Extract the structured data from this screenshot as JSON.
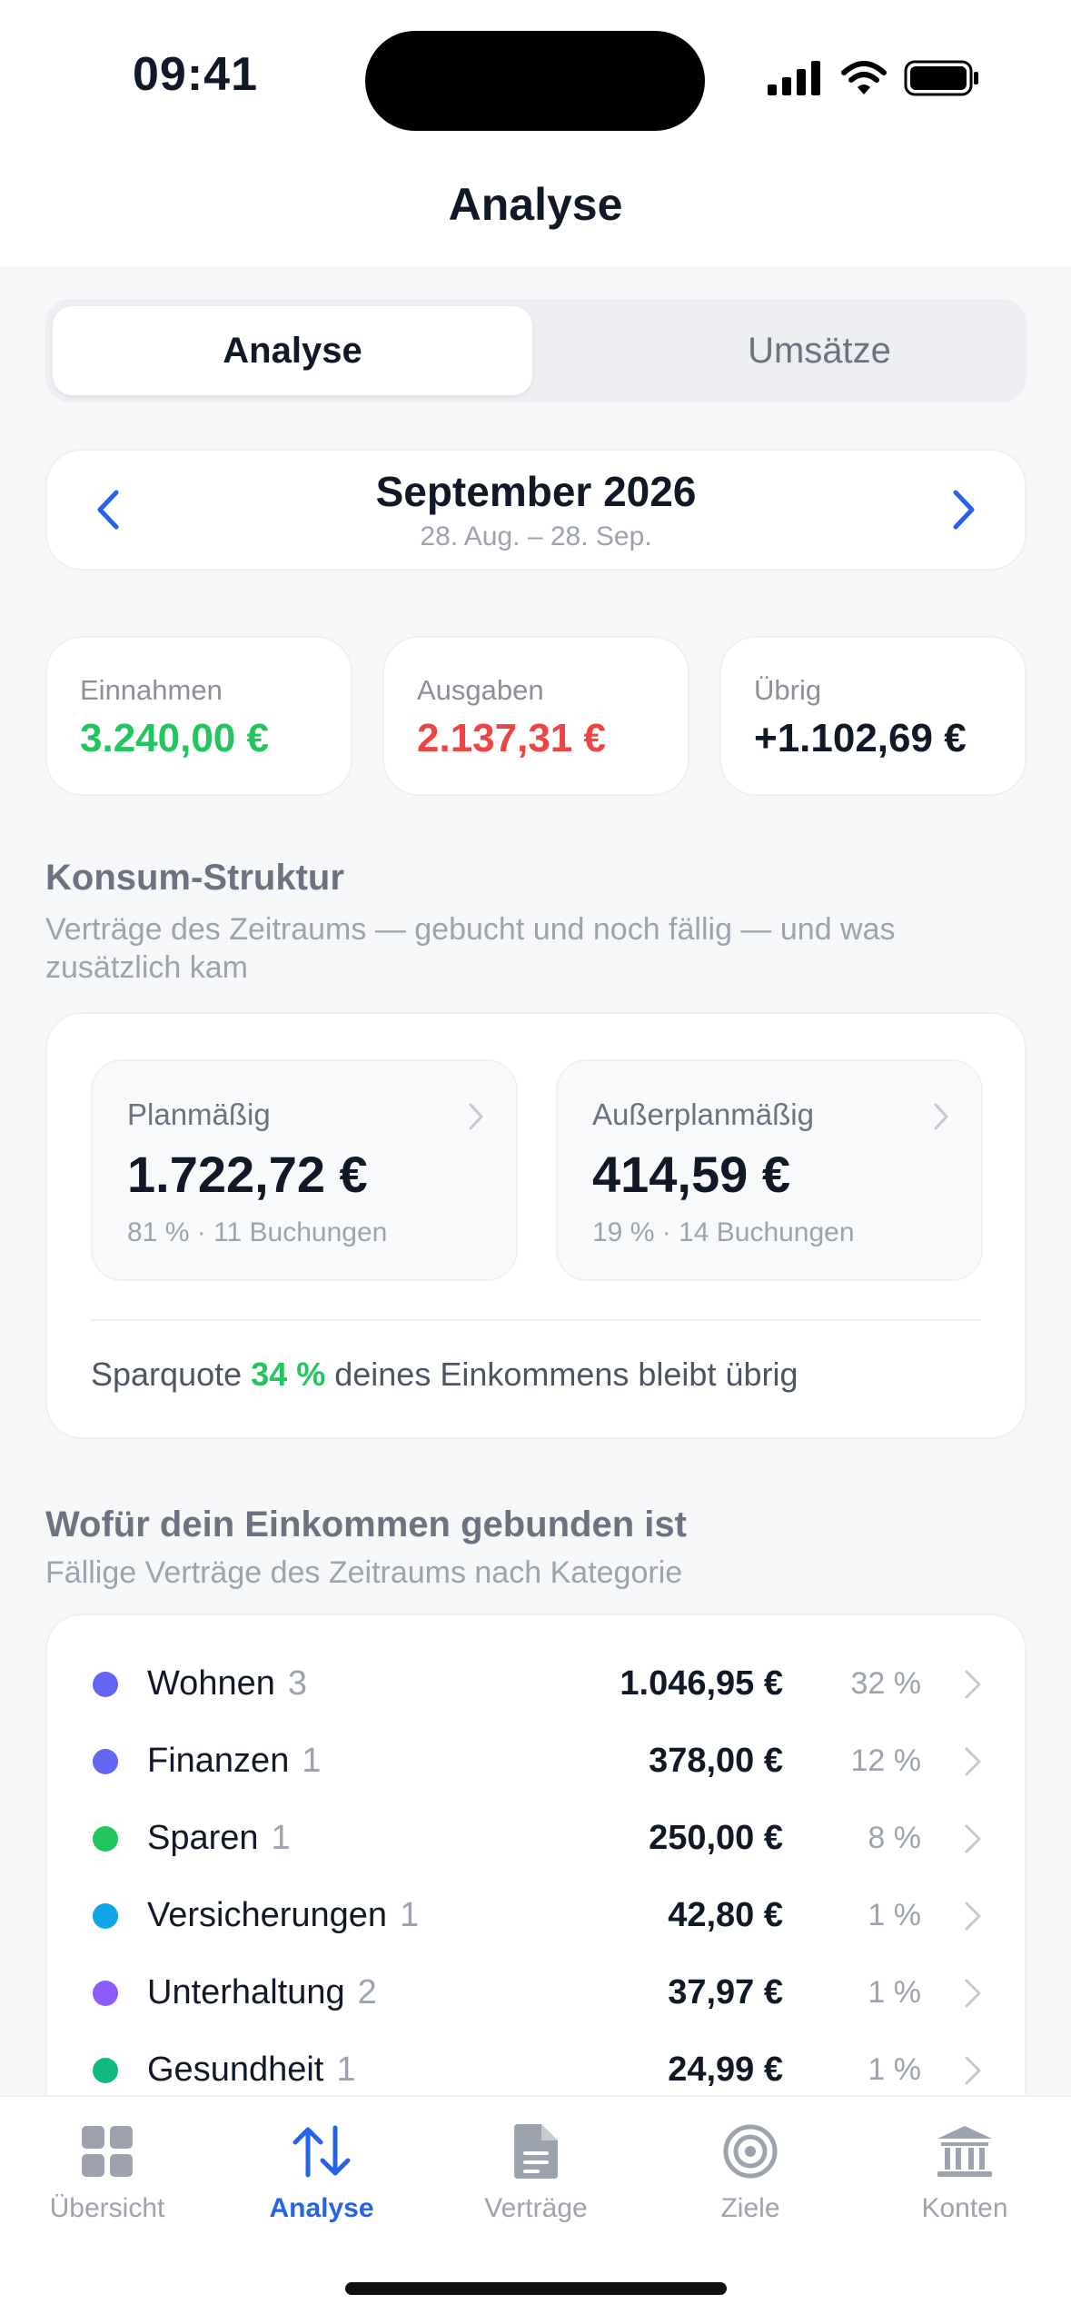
{
  "status": {
    "time": "09:41"
  },
  "nav": {
    "title": "Analyse"
  },
  "segment": {
    "active": "Analyse",
    "inactive": "Umsätze"
  },
  "period": {
    "title": "September 2026",
    "range": "28. Aug. – 28. Sep."
  },
  "stats": [
    {
      "label": "Einnahmen",
      "value": "3.240,00 €",
      "color": "#22c55e"
    },
    {
      "label": "Ausgaben",
      "value": "2.137,31 €",
      "color": "#ef4444"
    },
    {
      "label": "Übrig",
      "value": "+1.102,69 €",
      "color": "#111827"
    }
  ],
  "konsum": {
    "title": "Konsum-Struktur",
    "subtitle": "Verträge des Zeitraums — gebucht und noch fällig — und was zusätzlich kam",
    "planned": {
      "label": "Planmäßig",
      "value": "1.722,72 €",
      "meta": "81 % · 11 Buchungen"
    },
    "unplanned": {
      "label": "Außerplanmäßig",
      "value": "414,59 €",
      "meta": "19 % · 14 Buchungen"
    },
    "savings": {
      "prefix": "Sparquote",
      "pct": "34 %",
      "suffix": "deines Einkommens bleibt übrig"
    }
  },
  "categories": {
    "title": "Wofür dein Einkommen gebunden ist",
    "subtitle": "Fällige Verträge des Zeitraums nach Kategorie",
    "items": [
      {
        "name": "Wohnen",
        "count": "3",
        "amount": "1.046,95 €",
        "pct": "32 %",
        "color": "#6366f1"
      },
      {
        "name": "Finanzen",
        "count": "1",
        "amount": "378,00 €",
        "pct": "12 %",
        "color": "#6366f1"
      },
      {
        "name": "Sparen",
        "count": "1",
        "amount": "250,00 €",
        "pct": "8 %",
        "color": "#22c55e"
      },
      {
        "name": "Versicherungen",
        "count": "1",
        "amount": "42,80 €",
        "pct": "1 %",
        "color": "#0ea5e9"
      },
      {
        "name": "Unterhaltung",
        "count": "2",
        "amount": "37,97 €",
        "pct": "1 %",
        "color": "#8b5cf6"
      },
      {
        "name": "Gesundheit",
        "count": "1",
        "amount": "24,99 €",
        "pct": "1 %",
        "color": "#10b981"
      }
    ]
  },
  "tabs": [
    {
      "label": "Übersicht",
      "icon": "grid-icon"
    },
    {
      "label": "Analyse",
      "icon": "arrows-updown-icon"
    },
    {
      "label": "Verträge",
      "icon": "document-icon"
    },
    {
      "label": "Ziele",
      "icon": "target-icon"
    },
    {
      "label": "Konten",
      "icon": "bank-icon"
    }
  ],
  "colors": {
    "accent": "#2563eb",
    "income": "#22c55e",
    "expense": "#ef4444"
  }
}
